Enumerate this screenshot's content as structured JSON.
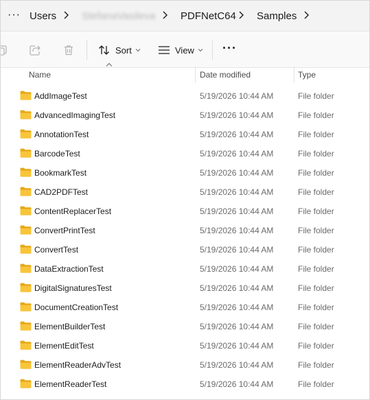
{
  "address": {
    "more_label": "···",
    "crumbs": [
      "Users",
      "StefanaVasileva",
      "PDFNetC64",
      "Samples"
    ]
  },
  "commandbar": {
    "sort_label": "Sort",
    "view_label": "View",
    "more_label": "···",
    "icons": [
      "copy-icon",
      "share-icon",
      "delete-icon",
      "sort-icon",
      "view-icon"
    ]
  },
  "columns": {
    "name": "Name",
    "date": "Date modified",
    "type": "Type",
    "sort_direction": "ascending"
  },
  "files": [
    {
      "name": "AddImageTest",
      "date": "5/19/2026 10:44 AM",
      "type": "File folder"
    },
    {
      "name": "AdvancedImagingTest",
      "date": "5/19/2026 10:44 AM",
      "type": "File folder"
    },
    {
      "name": "AnnotationTest",
      "date": "5/19/2026 10:44 AM",
      "type": "File folder"
    },
    {
      "name": "BarcodeTest",
      "date": "5/19/2026 10:44 AM",
      "type": "File folder"
    },
    {
      "name": "BookmarkTest",
      "date": "5/19/2026 10:44 AM",
      "type": "File folder"
    },
    {
      "name": "CAD2PDFTest",
      "date": "5/19/2026 10:44 AM",
      "type": "File folder"
    },
    {
      "name": "ContentReplacerTest",
      "date": "5/19/2026 10:44 AM",
      "type": "File folder"
    },
    {
      "name": "ConvertPrintTest",
      "date": "5/19/2026 10:44 AM",
      "type": "File folder"
    },
    {
      "name": "ConvertTest",
      "date": "5/19/2026 10:44 AM",
      "type": "File folder"
    },
    {
      "name": "DataExtractionTest",
      "date": "5/19/2026 10:44 AM",
      "type": "File folder"
    },
    {
      "name": "DigitalSignaturesTest",
      "date": "5/19/2026 10:44 AM",
      "type": "File folder"
    },
    {
      "name": "DocumentCreationTest",
      "date": "5/19/2026 10:44 AM",
      "type": "File folder"
    },
    {
      "name": "ElementBuilderTest",
      "date": "5/19/2026 10:44 AM",
      "type": "File folder"
    },
    {
      "name": "ElementEditTest",
      "date": "5/19/2026 10:44 AM",
      "type": "File folder"
    },
    {
      "name": "ElementReaderAdvTest",
      "date": "5/19/2026 10:44 AM",
      "type": "File folder"
    },
    {
      "name": "ElementReaderTest",
      "date": "5/19/2026 10:44 AM",
      "type": "File folder"
    }
  ],
  "colors": {
    "folder": "#f8c53a",
    "folder_back": "#e6a817",
    "secondary_text": "#6b6b6b",
    "disabled_icon": "#b5b5b5"
  }
}
